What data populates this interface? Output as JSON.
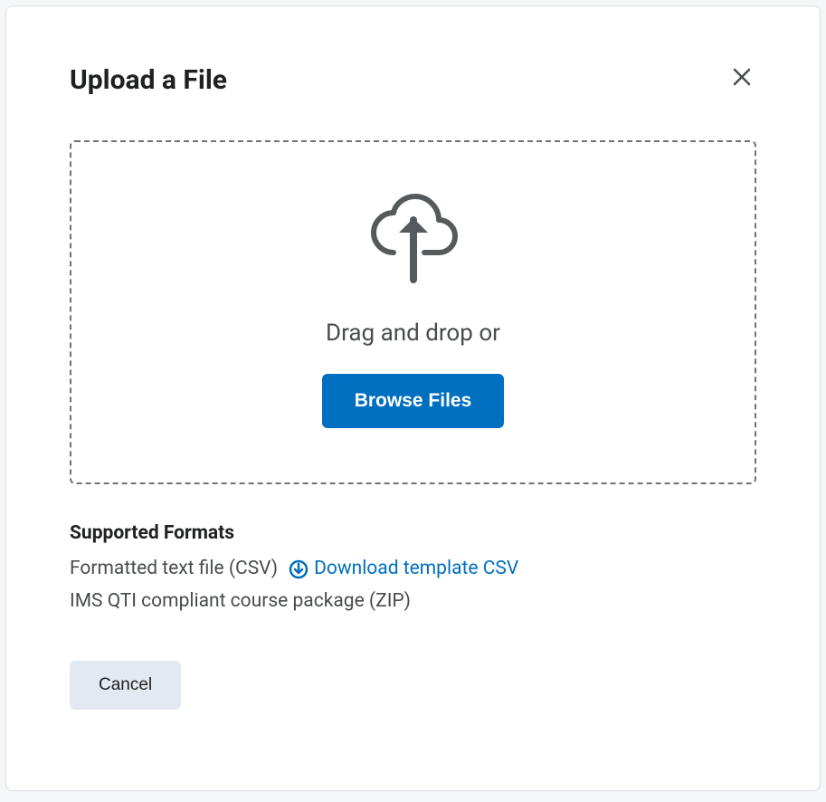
{
  "modal": {
    "title": "Upload a File",
    "close_label": "Close"
  },
  "dropzone": {
    "drag_text": "Drag and drop or",
    "browse_label": "Browse Files"
  },
  "supported": {
    "heading": "Supported Formats",
    "format_csv": "Formatted text file (CSV)",
    "download_template": "Download template CSV",
    "format_zip": "IMS QTI compliant course package (ZIP)"
  },
  "actions": {
    "cancel_label": "Cancel"
  },
  "colors": {
    "primary": "#006fbf",
    "text": "#202122",
    "muted": "#494c4e"
  }
}
